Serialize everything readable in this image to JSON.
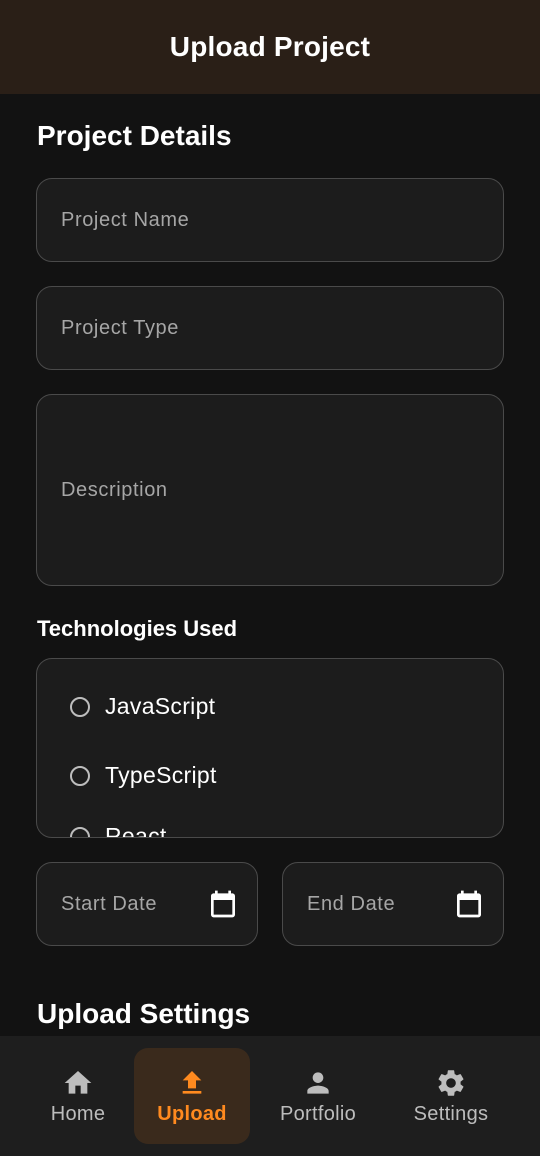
{
  "app_bar": {
    "title": "Upload Project"
  },
  "project_details": {
    "heading": "Project Details",
    "name_placeholder": "Project Name",
    "type_placeholder": "Project Type",
    "description_placeholder": "Description"
  },
  "technologies": {
    "heading": "Technologies Used",
    "options": [
      {
        "label": "JavaScript",
        "selected": false
      },
      {
        "label": "TypeScript",
        "selected": false
      },
      {
        "label": "React",
        "selected": false
      }
    ]
  },
  "dates": {
    "start_placeholder": "Start Date",
    "end_placeholder": "End Date",
    "icon": "calendar-icon"
  },
  "upload_settings": {
    "heading": "Upload Settings"
  },
  "bottom_nav": {
    "items": [
      {
        "label": "Home",
        "icon": "home-icon",
        "active": false
      },
      {
        "label": "Upload",
        "icon": "upload-icon",
        "active": true
      },
      {
        "label": "Portfolio",
        "icon": "person-icon",
        "active": false
      },
      {
        "label": "Settings",
        "icon": "gear-icon",
        "active": false
      }
    ]
  },
  "colors": {
    "app_bar_bg": "#2a1f17",
    "background": "#121212",
    "field_bg": "#1c1c1c",
    "field_border": "#4a4a4a",
    "accent": "#ff8a1f",
    "nav_active_bg": "#3a2a1c"
  }
}
